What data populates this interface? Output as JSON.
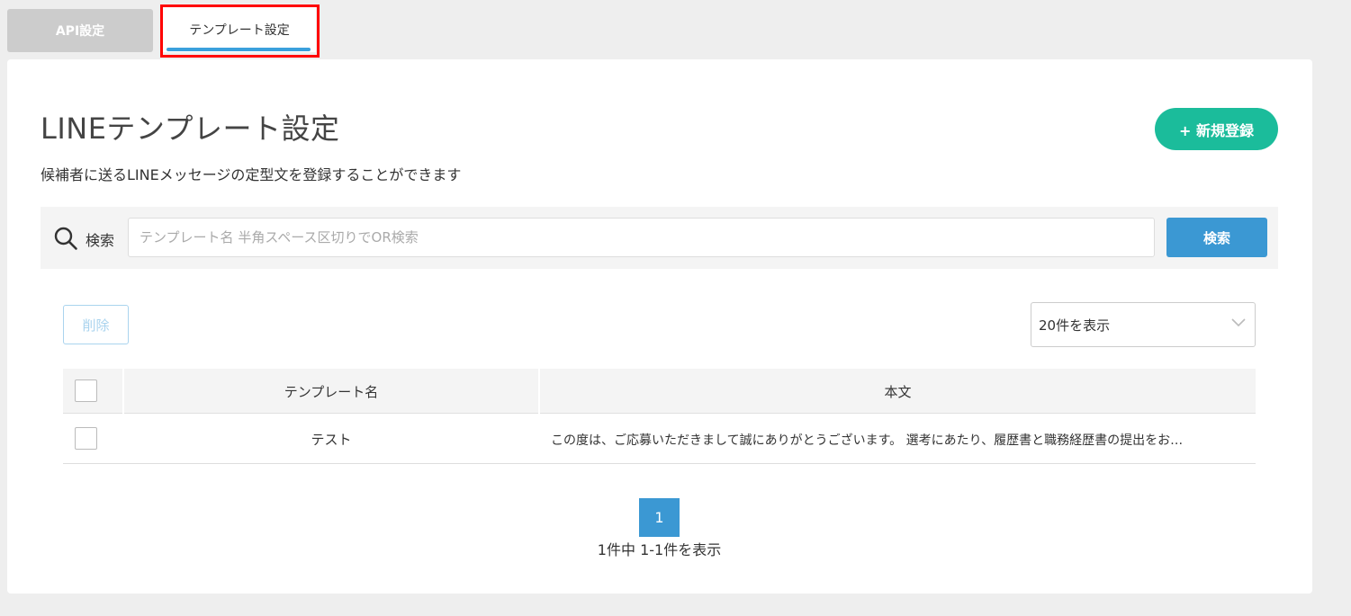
{
  "tabs": [
    {
      "label": "API設定",
      "active": false
    },
    {
      "label": "テンプレート設定",
      "active": true
    }
  ],
  "page": {
    "title": "LINEテンプレート設定",
    "description": "候補者に送るLINEメッセージの定型文を登録することができます",
    "new_button": "+ 新規登録"
  },
  "search": {
    "label": "検索",
    "placeholder": "テンプレート名 半角スペース区切りでOR検索",
    "value": "",
    "button": "検索"
  },
  "toolbar": {
    "delete_button": "削除",
    "page_size": "20件を表示"
  },
  "table": {
    "columns": [
      "テンプレート名",
      "本文"
    ],
    "rows": [
      {
        "name": "テスト",
        "body": "この度は、ご応募いただきまして誠にありがとうございます。 選考にあたり、履歴書と職務経歴書の提出をお…"
      }
    ]
  },
  "pagination": {
    "current_page": "1",
    "summary": "1件中 1-1件を表示"
  },
  "colors": {
    "accent_green": "#1bbc9b",
    "accent_blue": "#3b98d3",
    "highlight_red": "#ff0000"
  }
}
